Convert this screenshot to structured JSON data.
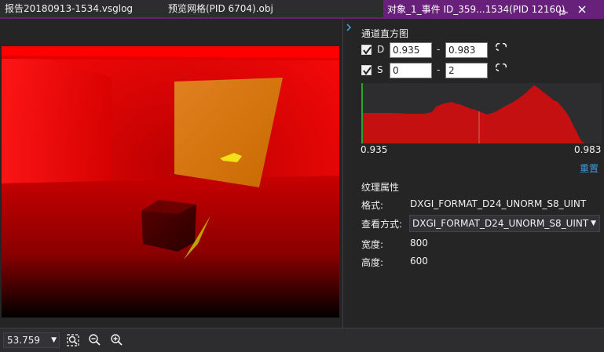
{
  "tabs": [
    {
      "label": "报告20180913-1534.vsglog"
    },
    {
      "label": "预览网格(PID 6704).obj"
    },
    {
      "label": "对象_1_事件 ID_359...1534(PID 12160)"
    }
  ],
  "icons": {
    "pin": "pin-icon",
    "close": "close-icon",
    "expand": "chevron-right-icon",
    "link": "link-icon",
    "zoom_fit": "zoom-fit-icon",
    "zoom_out": "zoom-out-icon",
    "zoom_in": "zoom-in-icon"
  },
  "colors": {
    "accent": "#68217a",
    "link": "#3e9bd6",
    "histogram_fill": "#c41010"
  },
  "histogram_panel": {
    "title": "通道直方图",
    "channels": [
      {
        "label": "D",
        "checked": true,
        "min": "0.935",
        "max": "0.983"
      },
      {
        "label": "S",
        "checked": true,
        "min": "0",
        "max": "2"
      }
    ],
    "dash": "-",
    "range_min": "0.935",
    "range_max": "0.983",
    "reset_label": "重置"
  },
  "texture_props": {
    "title": "纹理属性",
    "format_label": "格式:",
    "format_value": "DXGI_FORMAT_D24_UNORM_S8_UINT",
    "view_label": "查看方式:",
    "view_value": "DXGI_FORMAT_D24_UNORM_S8_UINT",
    "width_label": "宽度:",
    "width_value": "800",
    "height_label": "高度:",
    "height_value": "600"
  },
  "bottom_bar": {
    "zoom": "53.759"
  }
}
